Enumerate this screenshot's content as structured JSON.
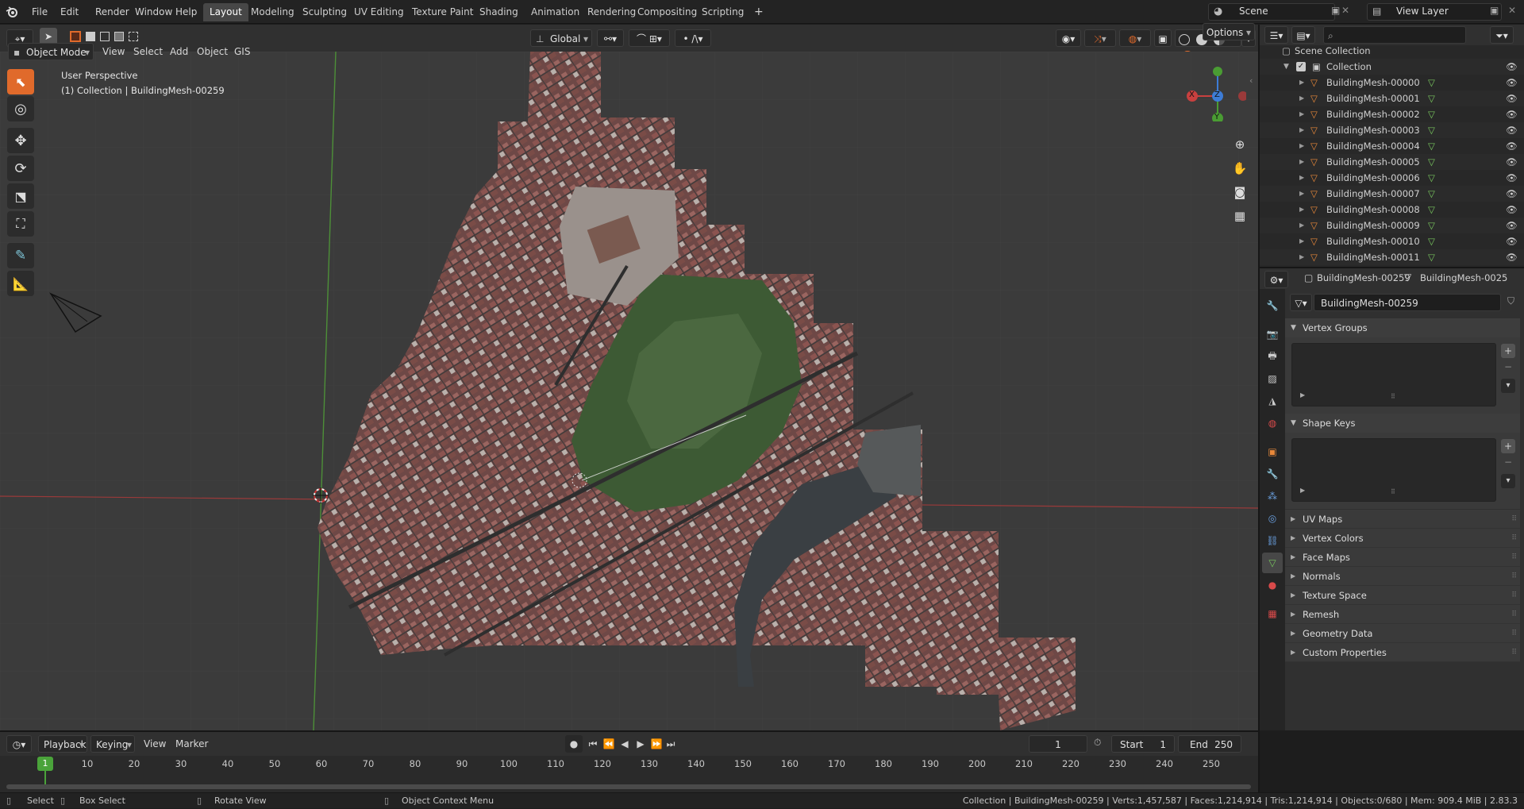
{
  "topbar": {
    "menus": [
      "File",
      "Edit",
      "Render",
      "Window",
      "Help"
    ],
    "workspaces": [
      "Layout",
      "Modeling",
      "Sculpting",
      "UV Editing",
      "Texture Paint",
      "Shading",
      "Animation",
      "Rendering",
      "Compositing",
      "Scripting"
    ],
    "active_workspace": "Layout",
    "add_workspace": "+",
    "scene": "Scene",
    "view_layer": "View Layer"
  },
  "viewport_header": {
    "mode": "Object Mode",
    "menus": [
      "View",
      "Select",
      "Add",
      "Object",
      "GIS"
    ],
    "orientation": "Global",
    "options": "Options"
  },
  "viewport": {
    "perspective_label": "User Perspective",
    "context_label": "(1) Collection | BuildingMesh-00259",
    "gizmo": {
      "x": "X",
      "y": "Y",
      "z": "Z"
    }
  },
  "outliner": {
    "search_placeholder": "",
    "scene_collection": "Scene Collection",
    "collection": "Collection",
    "items": [
      "BuildingMesh-00000",
      "BuildingMesh-00001",
      "BuildingMesh-00002",
      "BuildingMesh-00003",
      "BuildingMesh-00004",
      "BuildingMesh-00005",
      "BuildingMesh-00006",
      "BuildingMesh-00007",
      "BuildingMesh-00008",
      "BuildingMesh-00009",
      "BuildingMesh-00010",
      "BuildingMesh-00011"
    ]
  },
  "properties": {
    "breadcrumb_object": "BuildingMesh-00259",
    "breadcrumb_mesh": "BuildingMesh-0025",
    "mesh_name": "BuildingMesh-00259",
    "panels_open": [
      "Vertex Groups",
      "Shape Keys"
    ],
    "panels_closed": [
      "UV Maps",
      "Vertex Colors",
      "Face Maps",
      "Normals",
      "Texture Space",
      "Remesh",
      "Geometry Data",
      "Custom Properties"
    ]
  },
  "timeline": {
    "menus": [
      "Playback",
      "Keying",
      "View",
      "Marker"
    ],
    "current_frame": "1",
    "start_label": "Start",
    "start": "1",
    "end_label": "End",
    "end": "250",
    "ticks": [
      "10",
      "20",
      "30",
      "40",
      "50",
      "60",
      "70",
      "80",
      "90",
      "100",
      "110",
      "120",
      "130",
      "140",
      "150",
      "160",
      "170",
      "180",
      "190",
      "200",
      "210",
      "220",
      "230",
      "240",
      "250"
    ],
    "playhead": "1"
  },
  "statusbar": {
    "select": "Select",
    "box_select": "Box Select",
    "rotate_view": "Rotate View",
    "context_menu": "Object Context Menu",
    "stats": "Collection | BuildingMesh-00259 | Verts:1,457,587 | Faces:1,214,914 | Tris:1,214,914 | Objects:0/680 | Mem: 909.4 MiB | 2.83.3"
  },
  "colors": {
    "accent": "#e06a2b",
    "active_tab": "#474747",
    "x_axis": "#c8403f",
    "y_axis": "#4a9c33",
    "z_axis": "#3d7cd6",
    "mesh_icon": "#78c65e",
    "object_icon": "#e8883a"
  }
}
